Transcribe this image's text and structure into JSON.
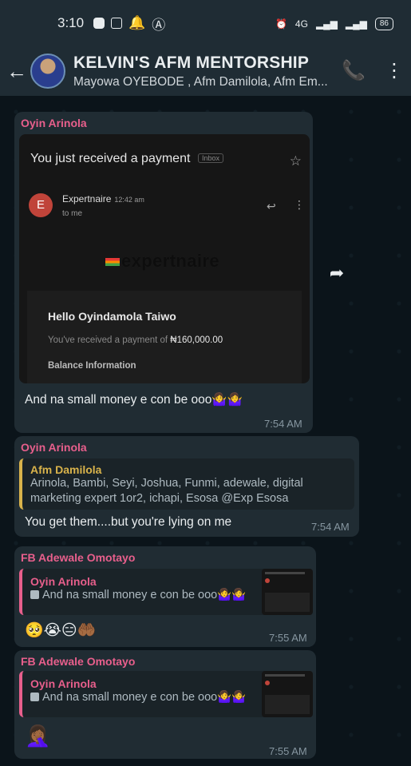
{
  "status_bar": {
    "time": "3:10",
    "battery": "86",
    "network": "4G"
  },
  "header": {
    "title": "KELVIN'S AFM MENTORSHIP",
    "subtitle": "Mayowa OYEBODE , Afm Damilola, Afm Em..."
  },
  "messages": [
    {
      "sender": "Oyin Arinola",
      "email": {
        "subject": "You just received a payment",
        "tag": "Inbox",
        "avatar_letter": "E",
        "from": "Expertnaire",
        "from_time": "12:42 am",
        "to": "to me",
        "brand": "expertnaire",
        "hello": "Hello Oyindamola Taiwo",
        "payment_prefix": "You've received a payment of",
        "amount": "₦160,000.00",
        "balance": "Balance Information"
      },
      "text": "And na small money e con be ooo🤷‍♀️🤷‍♀️",
      "time": "7:54 AM"
    },
    {
      "sender": "Oyin Arinola",
      "quote_name": "Afm Damilola",
      "quote_text": "Arinola, Bambi, Seyi, Joshua, Funmi, adewale, digital marketing expert 1or2, ichapi, Esosa @Exp Esosa",
      "text": "You get them....but you're lying on me",
      "time": "7:54 AM"
    },
    {
      "sender": "FB Adewale Omotayo",
      "quote_name": "Oyin Arinola",
      "quote_text": "And na small money e con be ooo🤷‍♀️🤷‍♀️",
      "text": "🥺😭😑🤲🏾",
      "time": "7:55 AM"
    },
    {
      "sender": "FB Adewale Omotayo",
      "quote_name": "Oyin Arinola",
      "quote_text": "And na small money e con be ooo🤷‍♀️🤷‍♀️",
      "text": "🤦🏾‍♀️",
      "time": "7:55 AM"
    }
  ],
  "colors": {
    "header_bg": "#1f2c34",
    "chat_bg": "#0b141a",
    "bubble_bg": "#202c33",
    "sender_pink": "#e85f8c",
    "quote_yellow": "#d9b34b"
  }
}
